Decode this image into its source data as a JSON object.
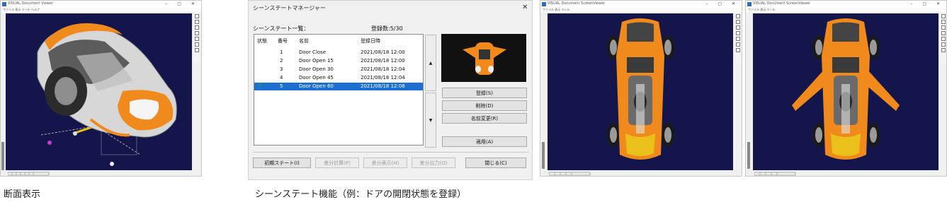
{
  "captions": {
    "left": "断面表示",
    "middle": "シーンステート機能（例：ドアの開閉状態を登録）"
  },
  "viewers": {
    "left": {
      "title": "VISUAL Document Viewer",
      "menu": "ファイル  表示  ツール  ヘルプ"
    },
    "right1": {
      "title": "VISUAL Document ScreenViewer",
      "menu": "ファイル  表示  ツール"
    },
    "right2": {
      "title": "VISUAL Document ScreenViewer",
      "menu": "ファイル  表示  ツール"
    }
  },
  "dialog": {
    "title": "シーンステートマネージャー",
    "list_title": "シーンステート一覧：",
    "count_label": "登録数",
    "count_value": "5/30",
    "columns": {
      "state": "状態",
      "number": "番号",
      "name": "名前",
      "date": "登録日時"
    },
    "rows": [
      {
        "number": "1",
        "name": "Door Close",
        "date": "2021/08/18 12:00",
        "checked": false,
        "selected": false
      },
      {
        "number": "2",
        "name": "Door Open 15",
        "date": "2021/08/18 12:00",
        "checked": false,
        "selected": false
      },
      {
        "number": "3",
        "name": "Door Open 30",
        "date": "2021/08/18 12:04",
        "checked": false,
        "selected": false
      },
      {
        "number": "4",
        "name": "Door Open 45",
        "date": "2021/08/18 12:04",
        "checked": false,
        "selected": false
      },
      {
        "number": "5",
        "name": "Door Open 60",
        "date": "2021/08/18 12:08",
        "checked": true,
        "selected": true
      }
    ],
    "buttons": {
      "register": "登録(S)",
      "delete": "削除(D)",
      "rename": "名前変更(R)",
      "apply": "適用(A)",
      "initial_state": "初期ステート(I)",
      "diff_calc": "差分計算(P)",
      "diff_show": "差分表示(H)",
      "diff_output": "差分出力(O)",
      "close": "閉じる(C)"
    },
    "up_arrow": "▲",
    "down_arrow": "▼",
    "close_glyph": "✕"
  },
  "colors": {
    "viewport_bg": "#14154a",
    "selection": "#1c6fd0",
    "check": "#1aa04a",
    "car_orange": "#f08a1c"
  },
  "icons": [
    "close-icon",
    "checkmark-icon",
    "scroll-up-icon",
    "scroll-down-icon",
    "app-icon"
  ]
}
